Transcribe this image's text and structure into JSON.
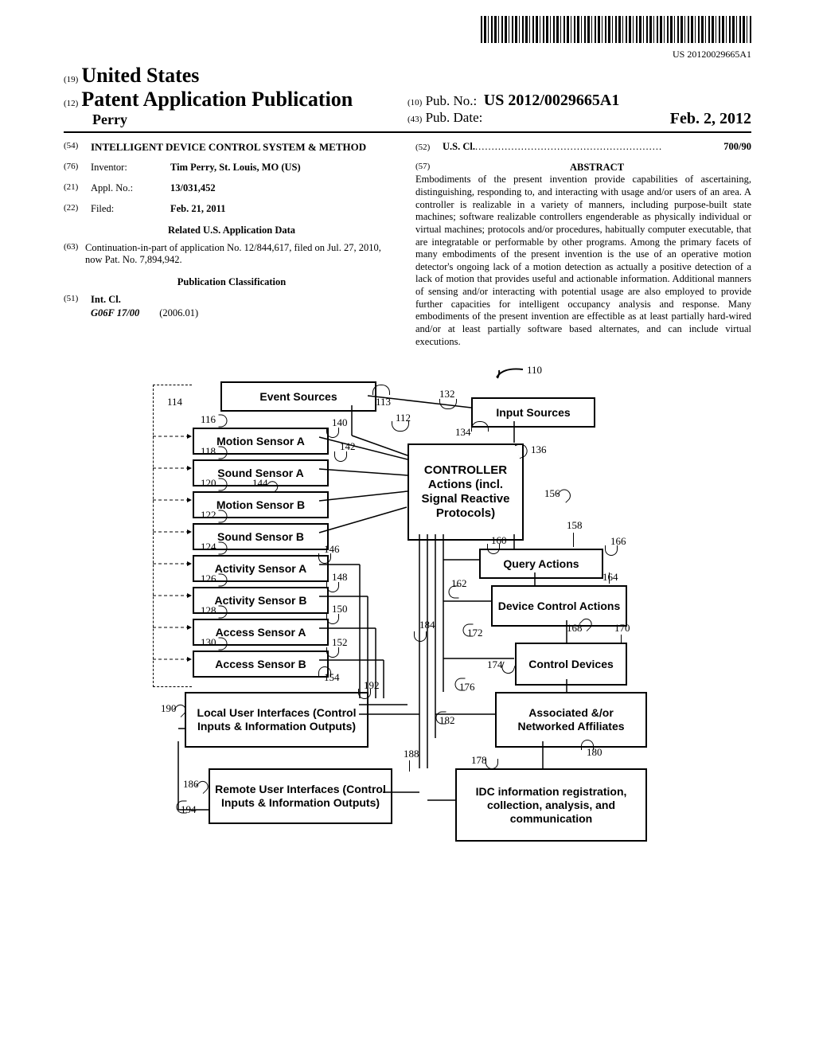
{
  "barcode_number": "US 20120029665A1",
  "header": {
    "code19": "(19)",
    "country": "United States",
    "code12": "(12)",
    "doc_type": "Patent Application Publication",
    "author_line": "Perry",
    "code10": "(10)",
    "pub_no_label": "Pub. No.:",
    "pub_no": "US 2012/0029665A1",
    "code43": "(43)",
    "pub_date_label": "Pub. Date:",
    "pub_date": "Feb. 2, 2012"
  },
  "left_col": {
    "c54": "(54)",
    "title": "INTELLIGENT DEVICE CONTROL SYSTEM & METHOD",
    "c76": "(76)",
    "inventor_label": "Inventor:",
    "inventor": "Tim Perry, St. Louis, MO (US)",
    "c21": "(21)",
    "appl_label": "Appl. No.:",
    "appl_no": "13/031,452",
    "c22": "(22)",
    "filed_label": "Filed:",
    "filed": "Feb. 21, 2011",
    "related_title": "Related U.S. Application Data",
    "c63": "(63)",
    "related_text": "Continuation-in-part of application No. 12/844,617, filed on Jul. 27, 2010, now Pat. No. 7,894,942.",
    "pub_class_title": "Publication Classification",
    "c51": "(51)",
    "intcl_label": "Int. Cl.",
    "intcl_code": "G06F 17/00",
    "intcl_year": "(2006.01)"
  },
  "right_col": {
    "c52": "(52)",
    "uscl_label": "U.S. Cl.",
    "uscl_val": "700/90",
    "c57": "(57)",
    "abstract_title": "ABSTRACT",
    "abstract_text": "Embodiments of the present invention provide capabilities of ascertaining, distinguishing, responding to, and interacting with usage and/or users of an area. A controller is realizable in a variety of manners, including purpose-built state machines; software realizable controllers engenderable as physically individual or virtual machines; protocols and/or procedures, habitually computer executable, that are integratable or performable by other programs. Among the primary facets of many embodiments of the present invention is the use of an operative motion detector's ongoing lack of a motion detection as actually a positive detection of a lack of motion that provides useful and actionable information. Additional manners of sensing and/or interacting with potential usage are also employed to provide further capacities for intelligent occupancy analysis and response. Many embodiments of the present invention are effectible as at least partially hard-wired and/or at least partially software based alternates, and can include virtual executions."
  },
  "diagram": {
    "n110": "110",
    "event_sources": "Event Sources",
    "input_sources": "Input Sources",
    "motion_a": "Motion Sensor A",
    "sound_a": "Sound Sensor A",
    "motion_b": "Motion Sensor B",
    "sound_b": "Sound Sensor B",
    "activity_a": "Activity Sensor A",
    "activity_b": "Activity Sensor B",
    "access_a": "Access Sensor A",
    "access_b": "Access Sensor B",
    "controller": "CONTROLLER Actions (incl. Signal Reactive Protocols)",
    "query": "Query Actions",
    "device_ctrl": "Device Control Actions",
    "ctrl_devices": "Control Devices",
    "affiliates": "Associated &/or Networked Affiliates",
    "idc": "IDC information registration, collection, analysis, and communication",
    "local_ui": "Local User Interfaces (Control Inputs & Information Outputs)",
    "remote_ui": "Remote User Interfaces (Control Inputs & Information Outputs)",
    "ref": {
      "n112": "112",
      "n113": "113",
      "n114": "114",
      "n116": "116",
      "n118": "118",
      "n120": "120",
      "n122": "122",
      "n124": "124",
      "n126": "126",
      "n128": "128",
      "n130": "130",
      "n132": "132",
      "n134": "134",
      "n136": "136",
      "n140": "140",
      "n142": "142",
      "n144": "144",
      "n146": "146",
      "n148": "148",
      "n150": "150",
      "n152": "152",
      "n154": "154",
      "n156": "156",
      "n158": "158",
      "n160": "160",
      "n162": "162",
      "n164": "164",
      "n166": "166",
      "n168": "168",
      "n170": "170",
      "n172": "172",
      "n174": "174",
      "n176": "176",
      "n178": "178",
      "n180": "180",
      "n182": "182",
      "n184": "184",
      "n186": "186",
      "n188": "188",
      "n190": "190",
      "n192": "192",
      "n194": "194"
    }
  }
}
